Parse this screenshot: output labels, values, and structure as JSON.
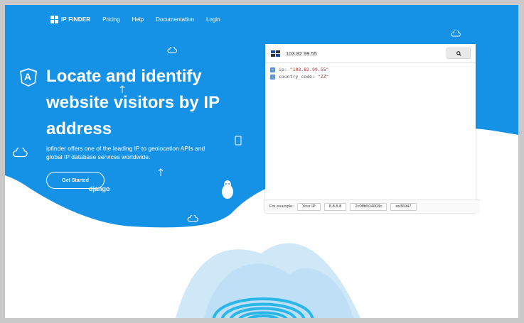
{
  "nav": {
    "brand": "IP FINDER",
    "links": [
      "Pricing",
      "Help",
      "Documentation",
      "Login"
    ]
  },
  "hero": {
    "headline": "Locate and identify website visitors by IP address",
    "subtext": "ipfinder offers one of the leading IP to geolocation APIs and global IP database services worldwide.",
    "cta_label": "Get Started",
    "django_label": "django",
    "angular_letter": "A"
  },
  "demo": {
    "ip_value": "103.82.99.55",
    "result": [
      {
        "key": "ip",
        "value": "\"103.82.99.55\""
      },
      {
        "key": "country_code",
        "value": "\"ZZ\""
      }
    ],
    "examples_label": "For example:",
    "examples": [
      "Your IP",
      "8.8.8.8",
      "2c0ffb504003c",
      "as36947"
    ]
  },
  "icons": {
    "search": "search-icon",
    "flag": "flag-icon",
    "cloud": "cloud-icon",
    "angular": "angular-icon",
    "linux": "tux-icon",
    "arrow": "arrow-up-icon",
    "fingerprint": "fingerprint-icon"
  },
  "colors": {
    "brand_blue": "#1592e6",
    "panel_bg": "#ffffff",
    "json_value": "#b02a2a",
    "fingerprint": "#2ab7e8"
  }
}
